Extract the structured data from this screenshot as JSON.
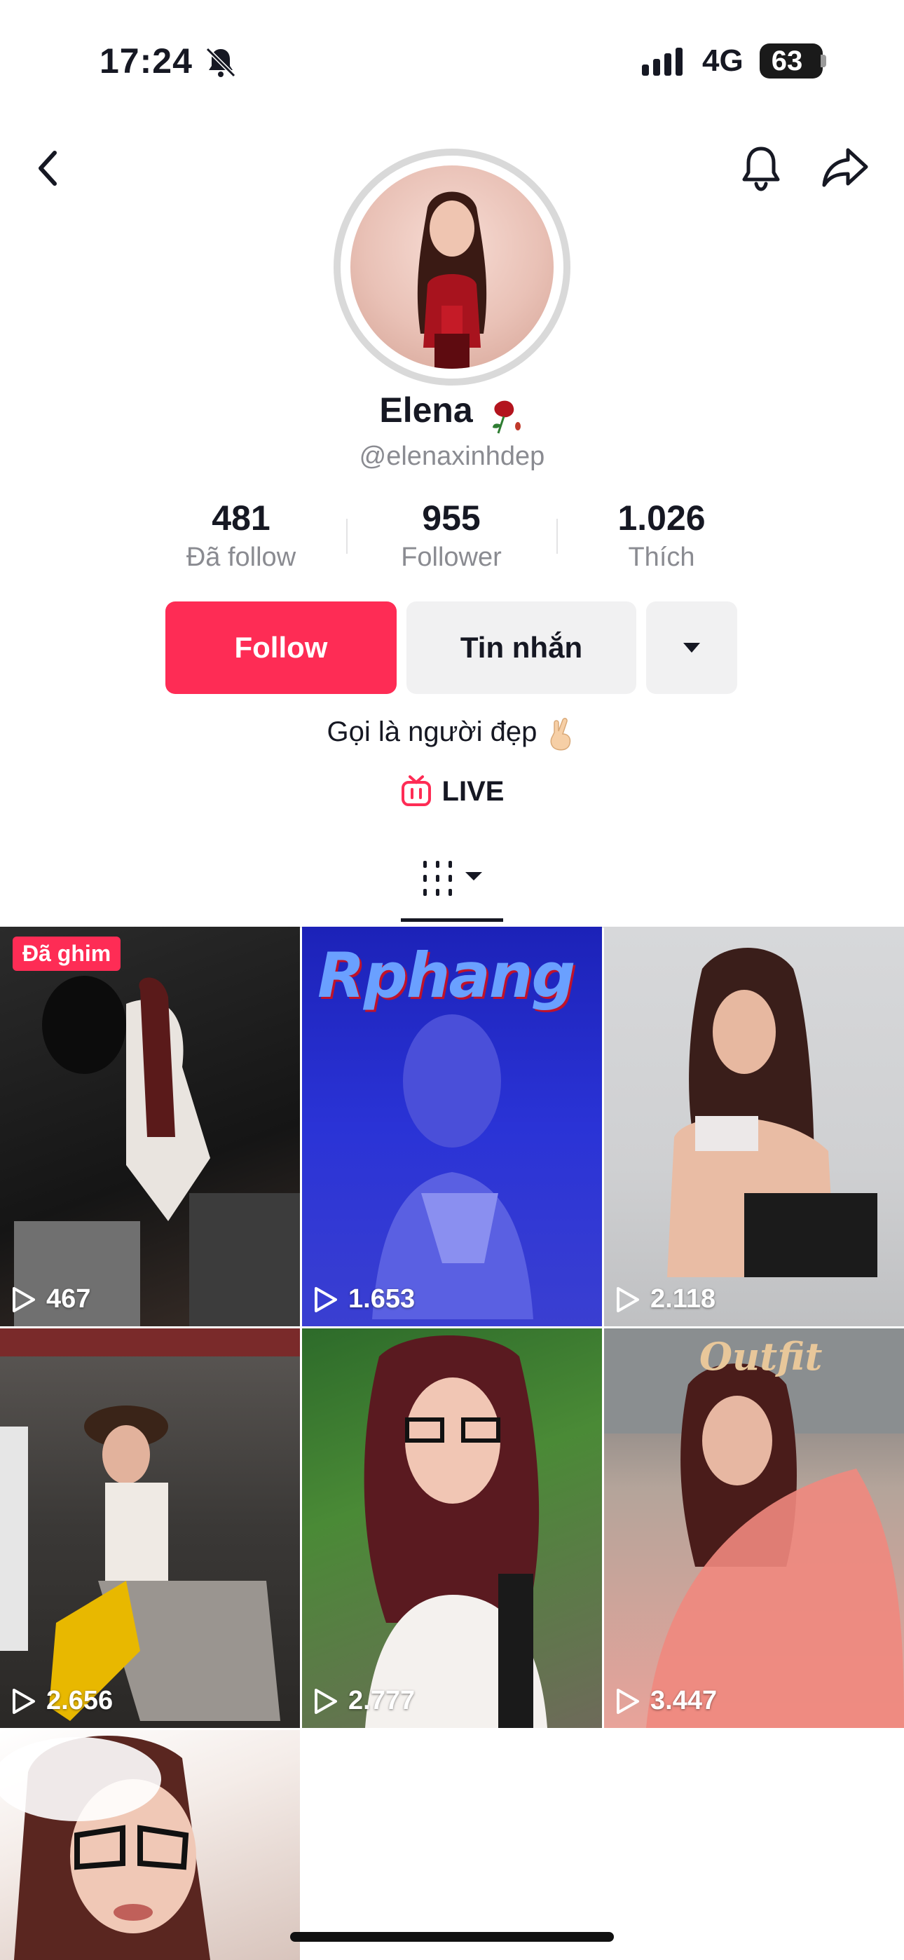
{
  "status_bar": {
    "time": "17:24",
    "network": "4G",
    "battery": "63"
  },
  "profile": {
    "name": "Elena",
    "username": "@elenaxinhdep",
    "stats": [
      {
        "value": "481",
        "label": "Đã follow"
      },
      {
        "value": "955",
        "label": "Follower"
      },
      {
        "value": "1.026",
        "label": "Thích"
      }
    ],
    "buttons": {
      "follow": "Follow",
      "message": "Tin nhắn"
    },
    "bio": "Gọi là người đẹp",
    "live_label": "LIVE"
  },
  "videos": [
    {
      "views": "467",
      "pinned_label": "Đã ghim"
    },
    {
      "views": "1.653",
      "overlay_text": "Rphang"
    },
    {
      "views": "2.118"
    },
    {
      "views": "2.656"
    },
    {
      "views": "2.777"
    },
    {
      "views": "3.447",
      "overlay_text": "Outfit"
    },
    {
      "views": ""
    }
  ],
  "colors": {
    "accent": "#fe2c55",
    "button_gray": "#f1f1f2",
    "text_secondary": "#8a8b91"
  }
}
